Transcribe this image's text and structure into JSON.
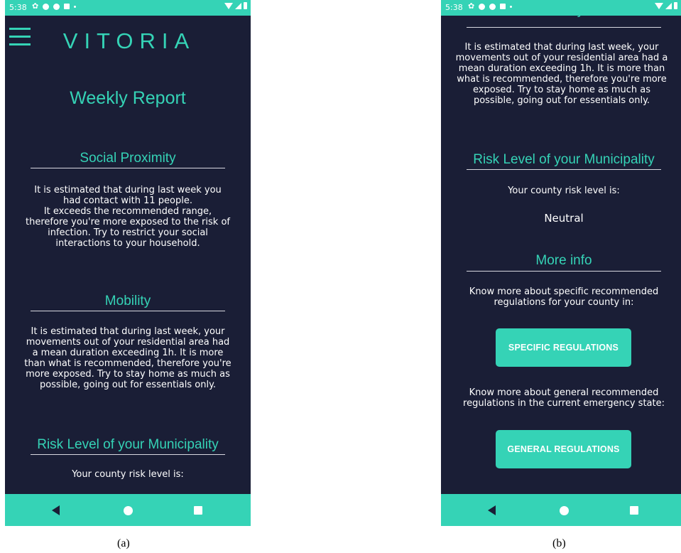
{
  "status_time": "5:38",
  "app_title": "VITORIA",
  "page_title": "Weekly Report",
  "sections": {
    "social": {
      "title": "Social Proximity",
      "text": "It is estimated that during last week you had contact with 11 people.\nIt exceeds the recommended range, therefore you're more exposed to the risk of infection. Try to restrict your social interactions to your household."
    },
    "mobility": {
      "title": "Mobility",
      "text": "It is estimated that during last week, your movements out of your residential area had a mean duration exceeding 1h. It is more than what is recommended, therefore you're more exposed. Try to stay home as much as possible, going out for essentials only."
    },
    "risk": {
      "title": "Risk Level of your Municipality",
      "intro": "Your county risk level is:",
      "level": "Neutral"
    },
    "more_info": {
      "title": "More info",
      "specific_text": "Know more about specific recommended regulations for your county in:",
      "specific_button": "SPECIFIC REGULATIONS",
      "general_text": "Know more about general recommended regulations in the current emergency state:",
      "general_button": "GENERAL REGULATIONS"
    }
  },
  "captions": {
    "a": "(a)",
    "b": "(b)"
  },
  "colors": {
    "background": "#1a1e36",
    "accent": "#35d3b6",
    "text": "#ffffff"
  },
  "icons": [
    "menu-icon",
    "gear-icon",
    "circle-icon",
    "shield-icon",
    "sim-icon",
    "wifi-icon",
    "signal-icon",
    "battery-icon",
    "back-icon",
    "home-icon",
    "recents-icon"
  ]
}
